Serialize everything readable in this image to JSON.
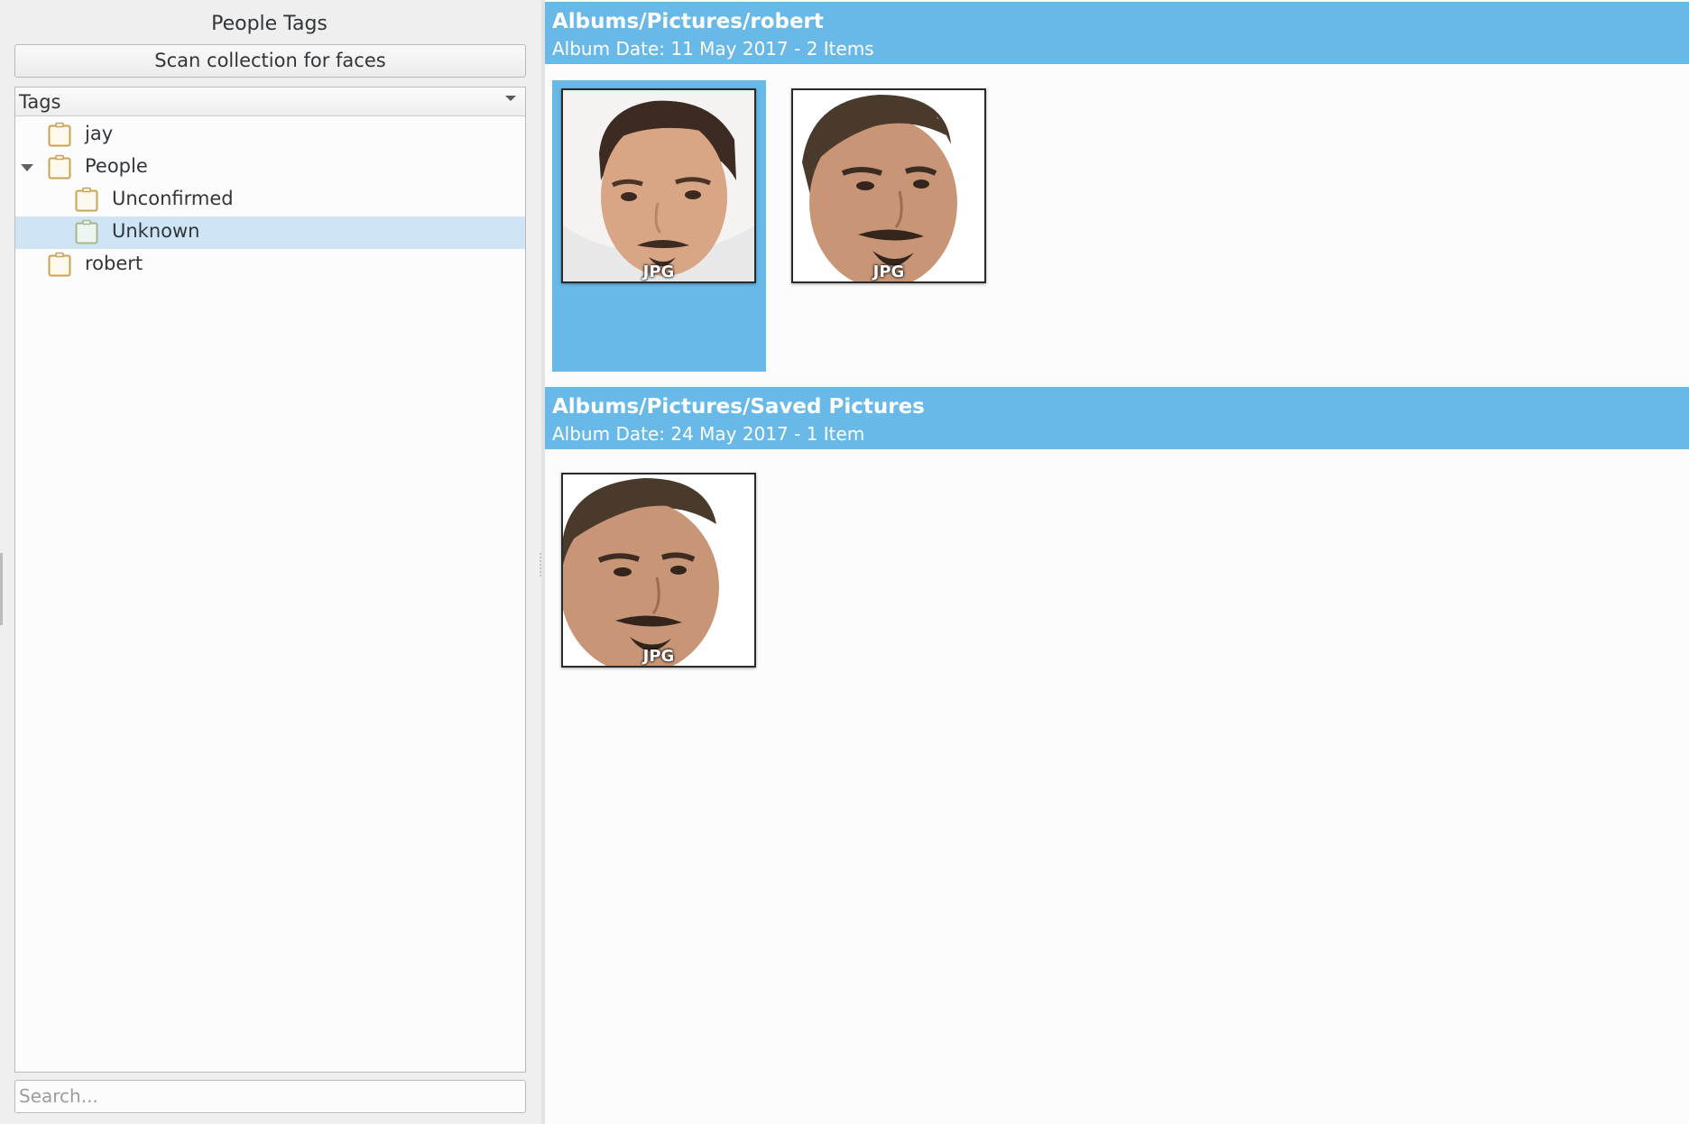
{
  "left_panel": {
    "title": "People Tags",
    "scan_button_label": "Scan collection for faces",
    "tree_header": "Tags",
    "tags": [
      {
        "label": "jay",
        "level": 0,
        "expanded": null,
        "selected": false
      },
      {
        "label": "People",
        "level": 0,
        "expanded": true,
        "selected": false
      },
      {
        "label": "Unconfirmed",
        "level": 1,
        "expanded": null,
        "selected": false
      },
      {
        "label": "Unknown",
        "level": 1,
        "expanded": null,
        "selected": true
      },
      {
        "label": "robert",
        "level": 0,
        "expanded": null,
        "selected": false
      }
    ],
    "search_placeholder": "Search..."
  },
  "albums": [
    {
      "title": "Albums/Pictures/robert",
      "subtitle": "Album Date: 11 May 2017 - 2 Items",
      "items": [
        {
          "type_badge": "JPG",
          "selected": true
        },
        {
          "type_badge": "JPG",
          "selected": false
        }
      ]
    },
    {
      "title": "Albums/Pictures/Saved Pictures",
      "subtitle": "Album Date: 24 May 2017 - 1 Item",
      "items": [
        {
          "type_badge": "JPG",
          "selected": false
        }
      ]
    }
  ],
  "colors": {
    "accent": "#69b9e8",
    "selection_tree": "#cfe5f5",
    "tag_icon": "#c9a253"
  }
}
